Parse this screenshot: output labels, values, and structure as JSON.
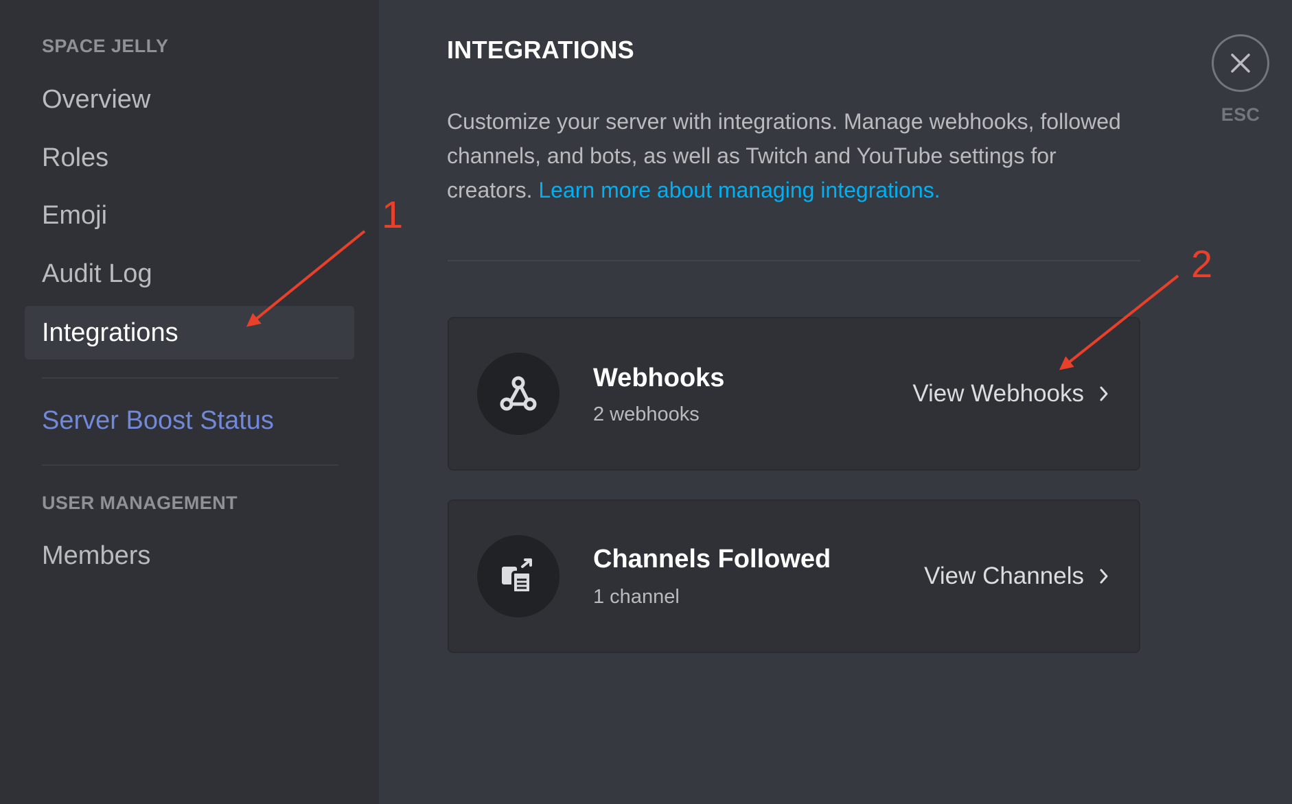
{
  "sidebar": {
    "server_header": "SPACE JELLY",
    "items": [
      {
        "label": "Overview"
      },
      {
        "label": "Roles"
      },
      {
        "label": "Emoji"
      },
      {
        "label": "Audit Log"
      },
      {
        "label": "Integrations",
        "active": true
      }
    ],
    "boost_label": "Server Boost Status",
    "user_management_header": "USER MANAGEMENT",
    "user_items": [
      {
        "label": "Members"
      }
    ]
  },
  "main": {
    "title": "INTEGRATIONS",
    "description": "Customize your server with integrations. Manage webhooks, followed channels, and bots, as well as Twitch and YouTube settings for creators.",
    "learn_more_link": "Learn more about managing integrations.",
    "cards": [
      {
        "title": "Webhooks",
        "subtitle": "2 webhooks",
        "action": "View Webhooks",
        "icon": "webhook-icon"
      },
      {
        "title": "Channels Followed",
        "subtitle": "1 channel",
        "action": "View Channels",
        "icon": "channels-followed-icon"
      }
    ]
  },
  "close": {
    "label": "ESC"
  },
  "annotations": {
    "first": "1",
    "second": "2"
  },
  "colors": {
    "sidebar_bg": "#2f3136",
    "main_bg": "#36393f",
    "link": "#00b0f4",
    "boost": "#7289da",
    "annotation": "#e8402a"
  }
}
